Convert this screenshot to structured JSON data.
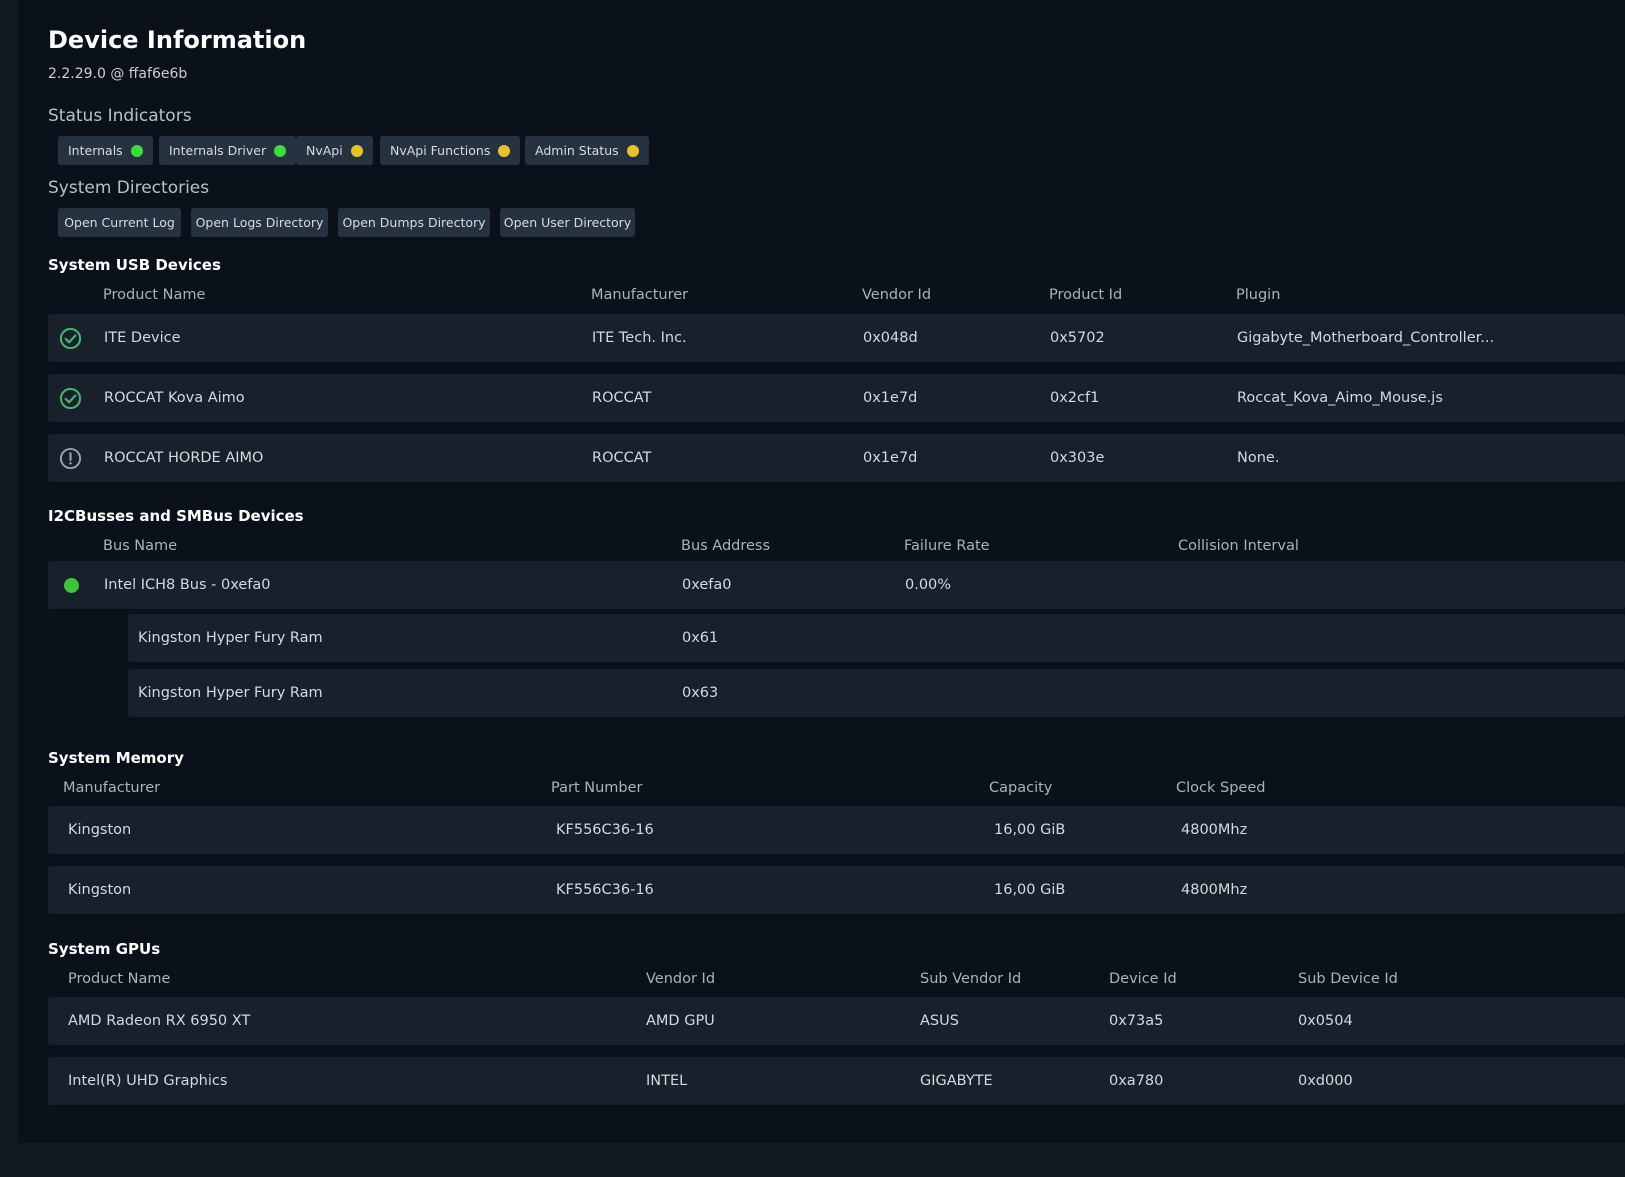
{
  "header": {
    "title": "Device Information",
    "version": "2.2.29.0 @ ffaf6e6b"
  },
  "status": {
    "heading": "Status Indicators",
    "items": [
      {
        "label": "Internals",
        "color": "#3ddc3d"
      },
      {
        "label": "Internals Driver",
        "color": "#3ddc3d"
      },
      {
        "label": "NvApi",
        "color": "#e6c22e"
      },
      {
        "label": "NvApi Functions",
        "color": "#e6c22e"
      },
      {
        "label": "Admin Status",
        "color": "#e6c22e"
      }
    ]
  },
  "directories": {
    "heading": "System Directories",
    "buttons": [
      "Open Current Log",
      "Open Logs Directory",
      "Open Dumps Directory",
      "Open User Directory"
    ]
  },
  "usb": {
    "heading": "System USB Devices",
    "columns": [
      "Product Name",
      "Manufacturer",
      "Vendor Id",
      "Product Id",
      "Plugin"
    ],
    "rows": [
      {
        "status": "check-circle-icon",
        "cells": [
          "ITE Device",
          "ITE Tech. Inc.",
          "0x048d",
          "0x5702",
          "Gigabyte_Motherboard_Controller..."
        ]
      },
      {
        "status": "check-circle-icon",
        "cells": [
          "ROCCAT Kova Aimo",
          "ROCCAT",
          "0x1e7d",
          "0x2cf1",
          "Roccat_Kova_Aimo_Mouse.js"
        ]
      },
      {
        "status": "warning-circle-icon",
        "cells": [
          "ROCCAT HORDE AIMO",
          "ROCCAT",
          "0x1e7d",
          "0x303e",
          "None."
        ]
      }
    ]
  },
  "i2c": {
    "heading": "I2CBusses and SMBus Devices",
    "columns": [
      "Bus Name",
      "Bus Address",
      "Failure Rate",
      "Collision Interval"
    ],
    "bus": {
      "status_color": "#3ddc3d",
      "name": "Intel ICH8 Bus - 0xefa0",
      "address": "0xefa0",
      "failure_rate": "0.00%"
    },
    "devices": [
      {
        "name": "Kingston Hyper Fury Ram",
        "address": "0x61"
      },
      {
        "name": "Kingston Hyper Fury Ram",
        "address": "0x63"
      }
    ]
  },
  "memory": {
    "heading": "System Memory",
    "columns": [
      "Manufacturer",
      "Part Number",
      "Capacity",
      "Clock Speed"
    ],
    "rows": [
      [
        "Kingston",
        "KF556C36-16",
        "16,00 GiB",
        "4800Mhz"
      ],
      [
        "Kingston",
        "KF556C36-16",
        "16,00 GiB",
        "4800Mhz"
      ]
    ]
  },
  "gpus": {
    "heading": "System GPUs",
    "columns": [
      "Product Name",
      "Vendor Id",
      "Sub Vendor Id",
      "Device Id",
      "Sub Device Id"
    ],
    "rows": [
      [
        "AMD Radeon RX 6950 XT",
        "AMD GPU",
        "ASUS",
        "0x73a5",
        "0x0504"
      ],
      [
        "Intel(R) UHD Graphics",
        "INTEL",
        "GIGABYTE",
        "0xa780",
        "0xd000"
      ]
    ]
  }
}
